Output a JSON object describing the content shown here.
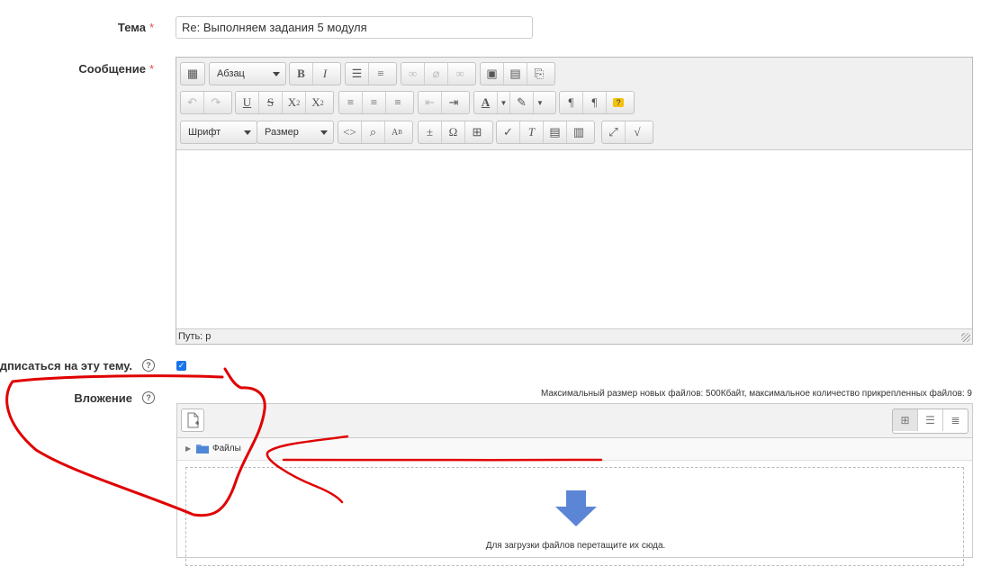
{
  "form": {
    "subject_label": "Тема",
    "subject_value": "Re: Выполняем задания 5 модуля",
    "message_label": "Сообщение",
    "subscribe_label": "Подписаться на эту тему.",
    "attachment_label": "Вложение",
    "required_mark": "*",
    "help_glyph": "?"
  },
  "editor": {
    "format_select": "Абзац",
    "font_select": "Шрифт",
    "size_select": "Размер",
    "status_path": "Путь: p"
  },
  "filepicker": {
    "max_info": "Максимальный размер новых файлов: 500Кбайт, максимальное количество прикрепленных файлов: 9",
    "folder_label": "Файлы",
    "drop_message": "Для загрузки файлов перетащите их сюда."
  },
  "colors": {
    "accent": "#1a73e8",
    "required": "#d9534f",
    "annotation": "#e00000",
    "arrow": "#5b86d6"
  }
}
